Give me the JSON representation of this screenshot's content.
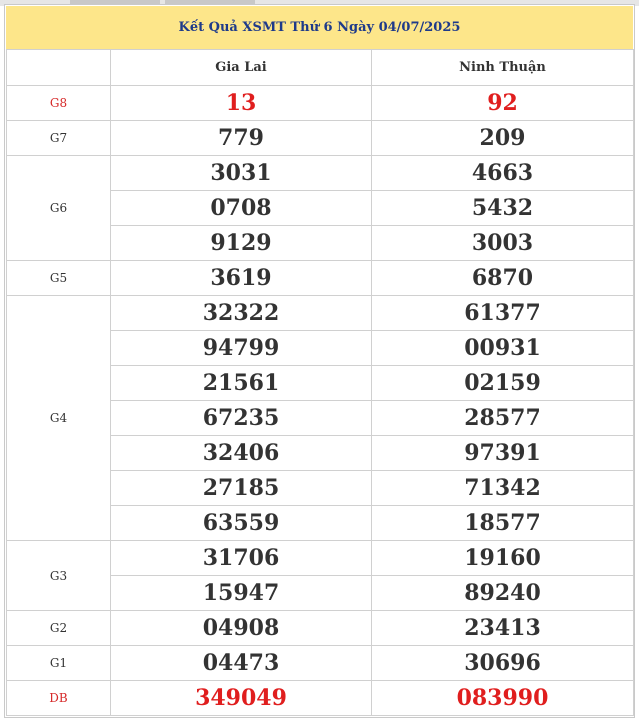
{
  "title": "Kết Quả XSMT Thứ 6 Ngày 04/07/2025",
  "provinces": [
    "Gia Lai",
    "Ninh Thuận"
  ],
  "prizes": {
    "g8": {
      "label": "G8",
      "gia_lai": [
        "13"
      ],
      "ninh_thuan": [
        "92"
      ]
    },
    "g7": {
      "label": "G7",
      "gia_lai": [
        "779"
      ],
      "ninh_thuan": [
        "209"
      ]
    },
    "g6": {
      "label": "G6",
      "gia_lai": [
        "3031",
        "0708",
        "9129"
      ],
      "ninh_thuan": [
        "4663",
        "5432",
        "3003"
      ]
    },
    "g5": {
      "label": "G5",
      "gia_lai": [
        "3619"
      ],
      "ninh_thuan": [
        "6870"
      ]
    },
    "g4": {
      "label": "G4",
      "gia_lai": [
        "32322",
        "94799",
        "21561",
        "67235",
        "32406",
        "27185",
        "63559"
      ],
      "ninh_thuan": [
        "61377",
        "00931",
        "02159",
        "28577",
        "97391",
        "71342",
        "18577"
      ]
    },
    "g3": {
      "label": "G3",
      "gia_lai": [
        "31706",
        "15947"
      ],
      "ninh_thuan": [
        "19160",
        "89240"
      ]
    },
    "g2": {
      "label": "G2",
      "gia_lai": [
        "04908"
      ],
      "ninh_thuan": [
        "23413"
      ]
    },
    "g1": {
      "label": "G1",
      "gia_lai": [
        "04473"
      ],
      "ninh_thuan": [
        "30696"
      ]
    },
    "db": {
      "label": "DB",
      "gia_lai": [
        "349049"
      ],
      "ninh_thuan": [
        "083990"
      ]
    }
  },
  "colors": {
    "header_bg": "#fde68a",
    "title_text": "#1e3a8a",
    "highlight": "#e01e1e"
  }
}
